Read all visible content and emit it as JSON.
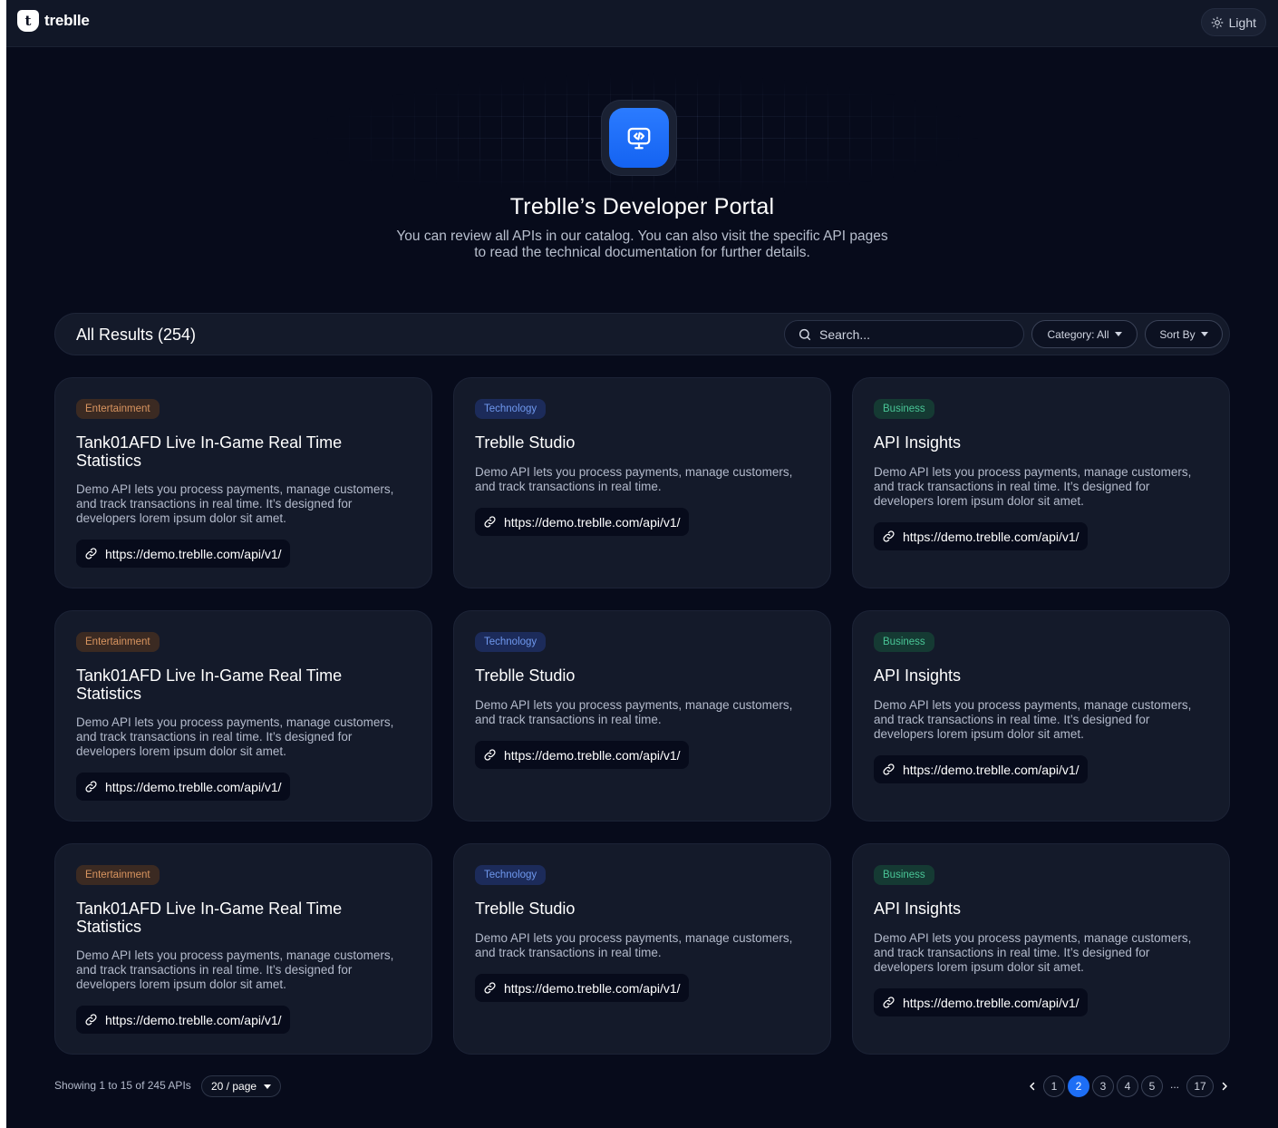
{
  "header": {
    "brand": "treblle",
    "brand_mark": "t",
    "theme_toggle_label": "Light",
    "theme_icon": "sun-icon"
  },
  "hero": {
    "icon": "code-monitor-icon",
    "title": "Treblle’s Developer Portal",
    "subtitle": "You can review all APIs in our catalog. You can also visit the specific API pages to read the technical documentation for further details."
  },
  "results": {
    "title": "All Results (254)",
    "search_placeholder": "Search...",
    "category_label": "Category: All",
    "sort_label": "Sort By"
  },
  "cards": [
    {
      "category": "Entertainment",
      "title": "Tank01AFD Live In-Game Real Time Statistics",
      "description": "Demo API lets you process payments, manage customers, and track transactions in real time. It’s designed for developers lorem ipsum dolor sit amet.",
      "url": "https://demo.treblle.com/api/v1/"
    },
    {
      "category": "Technology",
      "title": "Treblle Studio",
      "description": "Demo API lets you process payments, manage customers, and track transactions in real time.",
      "url": "https://demo.treblle.com/api/v1/"
    },
    {
      "category": "Business",
      "title": "API Insights",
      "description": "Demo API lets you process payments, manage customers, and track transactions in real time. It’s designed for developers lorem ipsum dolor sit amet.",
      "url": "https://demo.treblle.com/api/v1/"
    },
    {
      "category": "Entertainment",
      "title": "Tank01AFD Live In-Game Real Time Statistics",
      "description": "Demo API lets you process payments, manage customers, and track transactions in real time. It’s designed for developers lorem ipsum dolor sit amet.",
      "url": "https://demo.treblle.com/api/v1/"
    },
    {
      "category": "Technology",
      "title": "Treblle Studio",
      "description": "Demo API lets you process payments, manage customers, and track transactions in real time.",
      "url": "https://demo.treblle.com/api/v1/"
    },
    {
      "category": "Business",
      "title": "API Insights",
      "description": "Demo API lets you process payments, manage customers, and track transactions in real time. It’s designed for developers lorem ipsum dolor sit amet.",
      "url": "https://demo.treblle.com/api/v1/"
    },
    {
      "category": "Entertainment",
      "title": "Tank01AFD Live In-Game Real Time Statistics",
      "description": "Demo API lets you process payments, manage customers, and track transactions in real time. It’s designed for developers lorem ipsum dolor sit amet.",
      "url": "https://demo.treblle.com/api/v1/"
    },
    {
      "category": "Technology",
      "title": "Treblle Studio",
      "description": "Demo API lets you process payments, manage customers, and track transactions in real time.",
      "url": "https://demo.treblle.com/api/v1/"
    },
    {
      "category": "Business",
      "title": "API Insights",
      "description": "Demo API lets you process payments, manage customers, and track transactions in real time. It’s designed for developers lorem ipsum dolor sit amet.",
      "url": "https://demo.treblle.com/api/v1/"
    }
  ],
  "footer": {
    "showing": "Showing 1 to 15 of 245 APIs",
    "per_page": "20 / page",
    "pages": [
      "1",
      "2",
      "3",
      "4",
      "5"
    ],
    "ellipsis": "...",
    "last_page": "17",
    "current_page": "2"
  },
  "colors": {
    "background": "#070b1b",
    "accent": "#1d6ef5",
    "entertainment": "#d99560",
    "technology": "#6f98ee",
    "business": "#49c596"
  }
}
